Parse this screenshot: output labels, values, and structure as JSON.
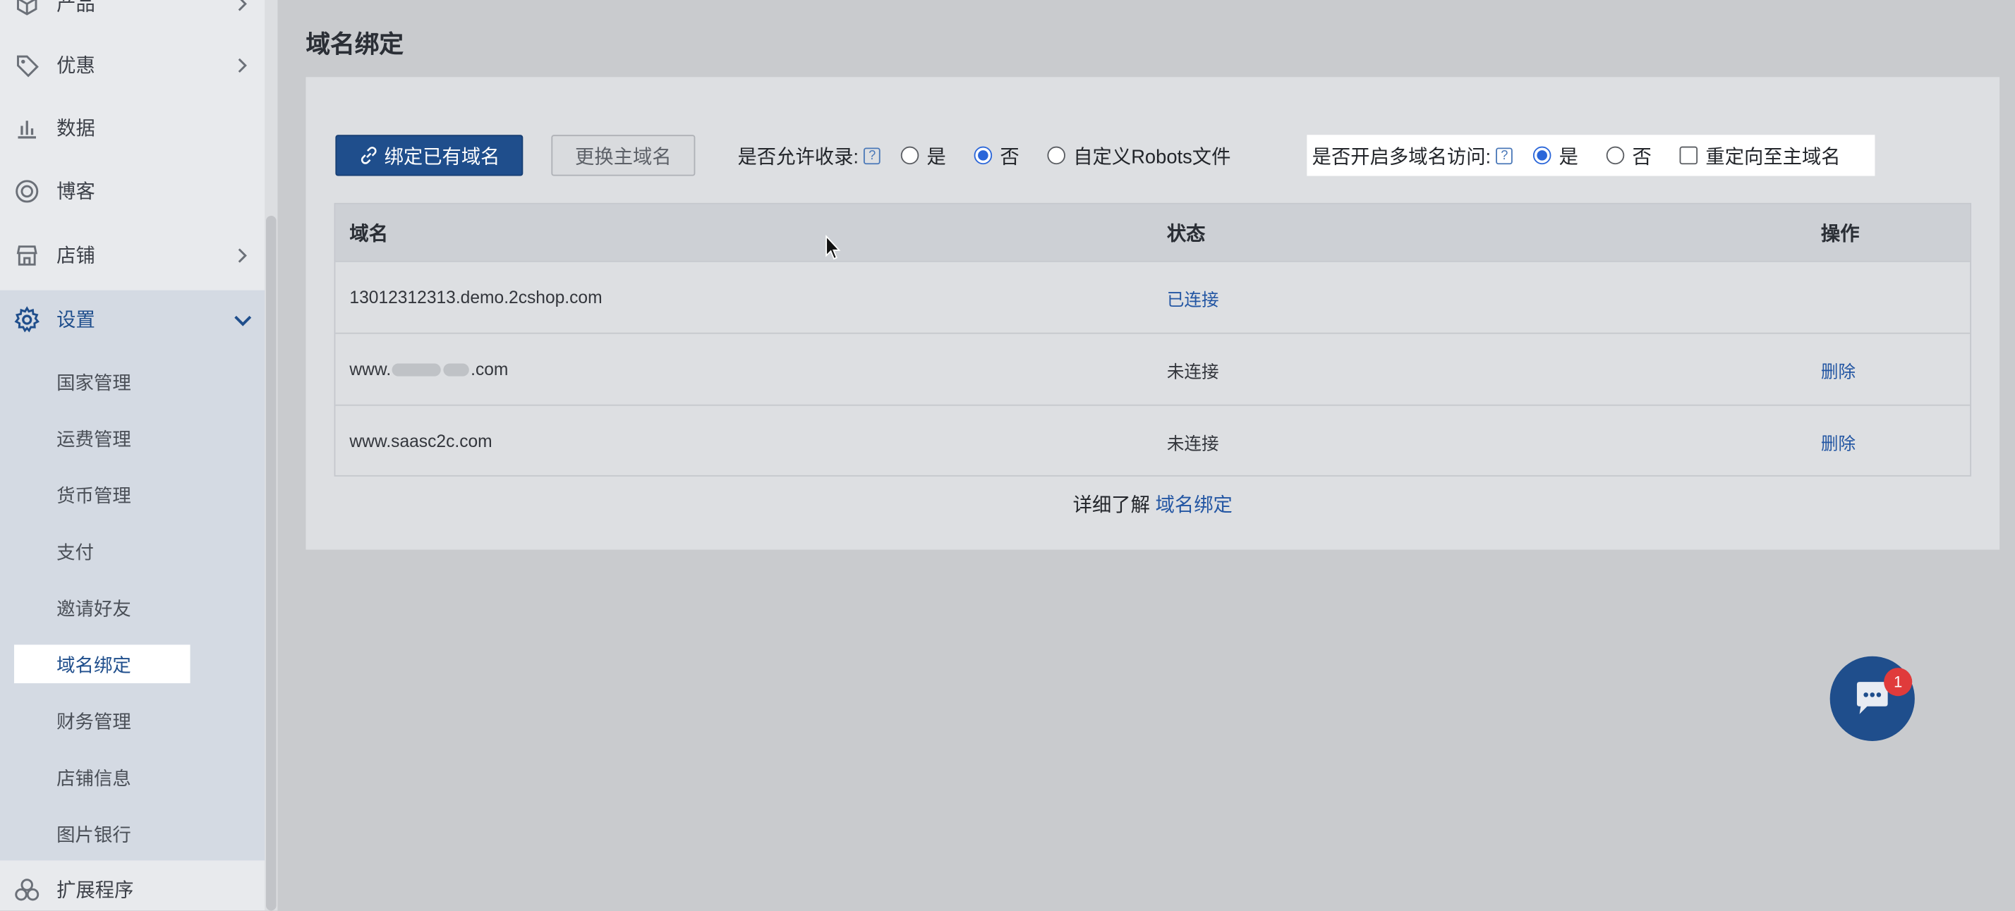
{
  "sidebar": {
    "items": [
      {
        "label": "产品",
        "icon": "box-icon",
        "has_chevron": true
      },
      {
        "label": "优惠",
        "icon": "tag-icon",
        "has_chevron": true
      },
      {
        "label": "数据",
        "icon": "bar-chart-icon",
        "has_chevron": false
      },
      {
        "label": "博客",
        "icon": "target-icon",
        "has_chevron": false
      },
      {
        "label": "店铺",
        "icon": "store-icon",
        "has_chevron": true
      },
      {
        "label": "设置",
        "icon": "gear-icon",
        "has_chevron": true,
        "expanded": true
      },
      {
        "label": "扩展程序",
        "icon": "apps-icon",
        "has_chevron": false
      }
    ],
    "settings_sub": [
      {
        "label": "国家管理"
      },
      {
        "label": "运费管理"
      },
      {
        "label": "货币管理"
      },
      {
        "label": "支付"
      },
      {
        "label": "邀请好友"
      },
      {
        "label": "域名绑定",
        "selected": true
      },
      {
        "label": "财务管理"
      },
      {
        "label": "店铺信息"
      },
      {
        "label": "图片银行"
      }
    ]
  },
  "main": {
    "title": "域名绑定",
    "bind_button": "绑定已有域名",
    "change_main_button": "更换主域名",
    "indexing": {
      "label": "是否允许收录:",
      "options": [
        "是",
        "否",
        "自定义Robots文件"
      ],
      "selected": "否"
    },
    "multi_domain": {
      "label": "是否开启多域名访问:",
      "options": [
        "是",
        "否"
      ],
      "selected": "是",
      "redirect_label": "重定向至主域名",
      "redirect_checked": false
    },
    "table": {
      "headers": [
        "域名",
        "状态",
        "操作"
      ],
      "rows": [
        {
          "domain": "13012312313.demo.2cshop.com",
          "status": "已连接",
          "action": ""
        },
        {
          "domain_prefix": "www.",
          "domain_suffix": ".com",
          "status": "未连接",
          "action": "删除"
        },
        {
          "domain": "www.saasc2c.com",
          "status": "未连接",
          "action": "删除"
        }
      ]
    },
    "more_prefix": "详细了解",
    "more_link": "域名绑定"
  },
  "chat": {
    "badge": "1"
  },
  "colors": {
    "accent": "#1f4e8c",
    "link": "#2356a3",
    "radio": "#2a66d9",
    "badge": "#e03b3b"
  }
}
